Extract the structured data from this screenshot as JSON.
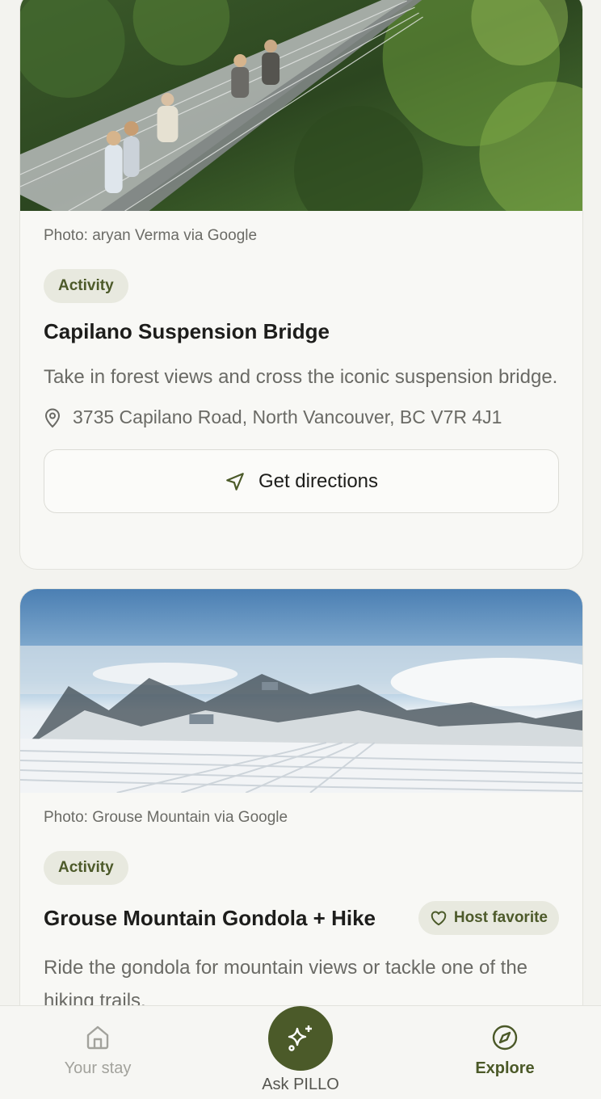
{
  "cards": [
    {
      "photo_credit": "Photo: aryan Verma via Google",
      "tag": "Activity",
      "title": "Capilano Suspension Bridge",
      "description": "Take in forest views and cross the iconic suspension bridge.",
      "address": "3735 Capilano Road, North Vancouver, BC V7R 4J1",
      "directions_label": "Get directions"
    },
    {
      "photo_credit": "Photo: Grouse Mountain via Google",
      "tag": "Activity",
      "title": "Grouse Mountain Gondola + Hike",
      "badge": "Host favorite",
      "description": "Ride the gondola for mountain views or tackle one of the hiking trails."
    }
  ],
  "tabbar": {
    "stay_label": "Your stay",
    "ask_label": "Ask PILLO",
    "explore_label": "Explore",
    "active_tab": "Explore"
  },
  "icons": {
    "location": "map-pin-icon",
    "directions": "navigation-arrow-icon",
    "favorite": "heart-icon",
    "home": "home-icon",
    "ask": "sparkles-icon",
    "explore": "compass-icon"
  },
  "colors": {
    "accent": "#4b5a29",
    "tag_bg": "#e8e9df",
    "tag_text": "#4d5a2a",
    "inactive": "#a2a29c"
  }
}
